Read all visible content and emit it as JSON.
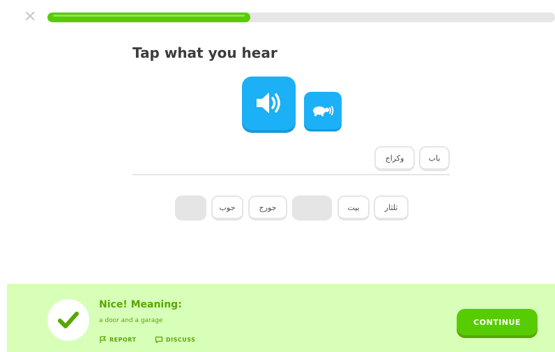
{
  "header": {
    "close_glyph": "✕",
    "progress_fraction": 0.4
  },
  "challenge": {
    "title": "Tap what you hear"
  },
  "answer_chips": [
    "باب",
    "وكراج"
  ],
  "bank_chips": [
    "ثلثار",
    "بيت",
    "",
    "جورج",
    "جوب",
    ""
  ],
  "footer": {
    "title": "Nice! Meaning:",
    "meaning": "a door and a garage",
    "report_label": "REPORT",
    "discuss_label": "DISCUSS",
    "continue_label": "CONTINUE"
  },
  "colors": {
    "accent_blue": "#1cb0f6",
    "accent_green": "#58cc02",
    "success_bg": "#d7ffb8",
    "success_text": "#58a700"
  },
  "icons": {
    "close": "close-icon",
    "speaker": "speaker-icon",
    "turtle": "turtle-slow-icon",
    "check": "check-icon",
    "report": "flag-icon",
    "discuss": "chat-bubble-icon"
  }
}
